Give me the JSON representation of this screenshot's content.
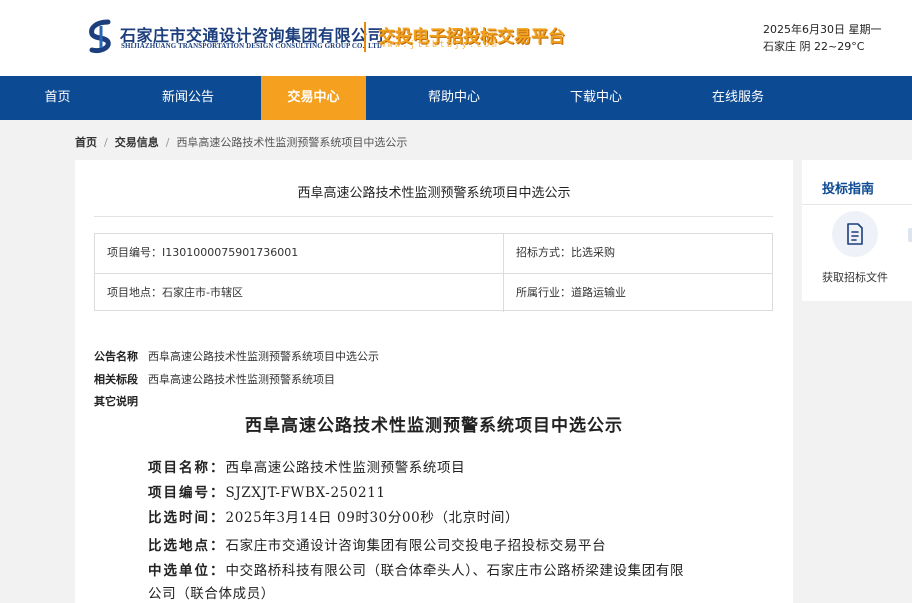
{
  "header": {
    "logo_cn": "石家庄市交通设计咨询集团有限公司",
    "logo_en": "SHIJIAZHUANG TRANSPORTATION DESIGN CONSULTING GROUP CO., LTD",
    "platform_name": "交投电子招投标交易平台",
    "platform_url": "www.jtzbtbjy.com",
    "date": "2025年6月30日 星期一",
    "weather": "石家庄 阴 22~29°C",
    "colors": {
      "brand_blue": "#1c3e7c",
      "accent_orange": "#f0a21c"
    }
  },
  "nav": {
    "items": [
      {
        "label": "首页"
      },
      {
        "label": "新闻公告"
      },
      {
        "label": "交易中心",
        "active": true
      },
      {
        "label": "帮助中心"
      },
      {
        "label": "下载中心"
      },
      {
        "label": "在线服务"
      }
    ],
    "colors": {
      "bar": "#0d4a94",
      "active": "#f5a01f"
    }
  },
  "breadcrumb": {
    "home": "首页",
    "section": "交易信息",
    "current": "西阜高速公路技术性监测预警系统项目中选公示"
  },
  "main": {
    "title": "西阜高速公路技术性监测预警系统项目中选公示",
    "info": {
      "project_no": "项目编号：I1301000075901736001",
      "bid_method": "招标方式：比选采购",
      "location": "项目地点：石家庄市-市辖区",
      "industry": "所属行业：道路运输业"
    },
    "meta": {
      "notice_name_label": "公告名称",
      "notice_name_value": "西阜高速公路技术性监测预警系统项目中选公示",
      "related_label": "相关标段",
      "related_value": "西阜高速公路技术性监测预警系统项目",
      "other_label": "其它说明"
    },
    "doc": {
      "title": "西阜高速公路技术性监测预警系统项目中选公示",
      "lines": [
        {
          "key": "项目名称：",
          "value": "西阜高速公路技术性监测预警系统项目"
        },
        {
          "key": "项目编号：",
          "value": "SJZXJT-FWBX-250211"
        },
        {
          "key": "比选时间：",
          "value": "2025年3月14日 09时30分00秒（北京时间）"
        },
        {
          "key": "比选地点：",
          "value": "石家庄市交通设计咨询集团有限公司交投电子招投标交易平台"
        },
        {
          "key": "中选单位：",
          "value": "中交路桥科技有限公司（联合体牵头人）、石家庄市公路桥梁建设集团有限"
        },
        {
          "key": "",
          "value": "公司（联合体成员）"
        }
      ]
    }
  },
  "sidebar": {
    "title": "投标指南",
    "download_label": "获取招标文件",
    "icon": "document-icon"
  }
}
